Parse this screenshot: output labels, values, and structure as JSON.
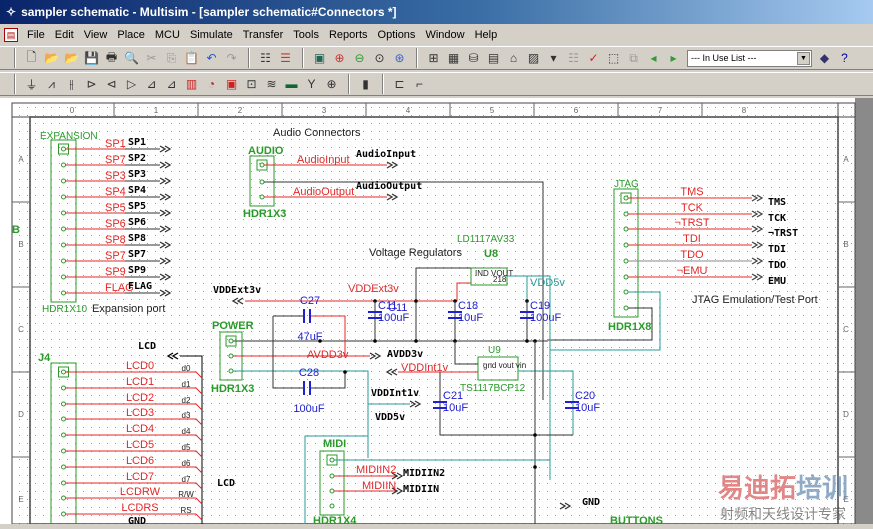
{
  "window": {
    "title": "sampler schematic - Multisim - [sampler schematic#Connectors *]"
  },
  "menu": [
    "File",
    "Edit",
    "View",
    "Place",
    "MCU",
    "Simulate",
    "Transfer",
    "Tools",
    "Reports",
    "Options",
    "Window",
    "Help"
  ],
  "toolbar": {
    "in_use_list": "--- In Use List ---"
  },
  "ruler": {
    "columns": [
      "0",
      "1",
      "2",
      "3",
      "4",
      "5",
      "6",
      "7",
      "8"
    ],
    "rows": [
      "A",
      "B",
      "C",
      "D",
      "E"
    ],
    "marker": "B"
  },
  "schematic": {
    "audio_title": "Audio Connectors",
    "regulators_title": "Voltage Regulators",
    "expansion": {
      "ref": "EXPANSION",
      "model": "HDR1X10",
      "caption": "Expansion port",
      "net_labels": [
        "SP1",
        "SP7",
        "SP3",
        "SP4",
        "SP5",
        "SP6",
        "SP8",
        "SP7",
        "SP9",
        "FLAG"
      ],
      "ports": [
        "SP1",
        "SP2",
        "SP3",
        "SP4",
        "SP5",
        "SP6",
        "SP8",
        "SP7",
        "SP9",
        "FLAG"
      ]
    },
    "audio": {
      "ref": "AUDIO",
      "model": "HDR1X3",
      "net_labels": [
        "AudioInput",
        "AudioOutput"
      ],
      "ports": [
        "AudioInput",
        "AudioOutput"
      ]
    },
    "jtag": {
      "ref": "JTAG",
      "model": "HDR1X8",
      "caption": "JTAG Emulation/Test Port",
      "net_labels": [
        "TMS",
        "TCK",
        "¬TRST",
        "TDI",
        "TDO",
        "¬EMU"
      ],
      "ports": [
        "TMS",
        "TCK",
        "¬TRST",
        "TDI",
        "TDO",
        "EMU"
      ]
    },
    "power": {
      "ref": "POWER",
      "model": "HDR1X3"
    },
    "midi": {
      "ref": "MIDI",
      "model": "HDR1X4",
      "net_labels": [
        "MIDIIN2",
        "MIDIIN"
      ],
      "ports": [
        "MIDIIN2",
        "MIDIIN"
      ]
    },
    "j4": {
      "ref": "J4",
      "port": "LCD",
      "port2": "LCD",
      "gnd": "GND",
      "net_labels": [
        "LCD0",
        "LCD1",
        "LCD2",
        "LCD3",
        "LCD4",
        "LCD5",
        "LCD6",
        "LCD7",
        "LCDRW",
        "LCDRS"
      ],
      "bus_labels": [
        "d0",
        "d1",
        "d2",
        "d3",
        "d4",
        "d5",
        "d6",
        "d7",
        "R/W",
        "RS"
      ]
    },
    "u8": {
      "ref": "U8",
      "model": "LD1117AV33",
      "pins": "IND VOUT",
      "pin2": "218"
    },
    "u9": {
      "ref": "U9",
      "model": "TS1117BCP12",
      "pins": "gnd vout vin"
    },
    "nets": {
      "vddext_port": "VDDExt3v",
      "vddext": "VDDExt3v",
      "vdd5v": "VDD5v",
      "avdd_label": "AVDD3v",
      "avdd_port": "AVDD3v",
      "vddint_label": "VDDInt1v",
      "vddint_port": "VDDInt1v",
      "vdd5v_port": "VDD5v",
      "gnd": "GND",
      "buttons": "BUTTONS"
    },
    "caps": [
      {
        "ref": "C27",
        "value": "47uF"
      },
      {
        "ref": "C28",
        "value": "100uF"
      },
      {
        "ref": "C11",
        "value": "100uF"
      },
      {
        "ref": "C18",
        "value": "10uF"
      },
      {
        "ref": "C19",
        "value": "100uF"
      },
      {
        "ref": "C21",
        "value": "10uF"
      },
      {
        "ref": "C20",
        "value": "10uF"
      }
    ]
  },
  "watermark": {
    "line1a": "易迪拓",
    "line1b": "培训",
    "line2": "射频和天线设计专家"
  },
  "colors": {
    "net_label": "#e02828",
    "component": "#2a9a2a",
    "capacitor": "#2020d0",
    "power_net": "#2a9a9a",
    "title_bar": "#0a246a"
  }
}
